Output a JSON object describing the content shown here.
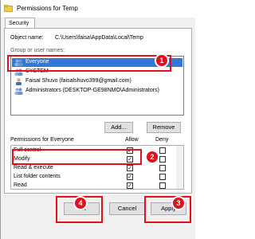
{
  "window": {
    "title": "Permissions for Temp"
  },
  "tabs": [
    {
      "label": "Security"
    }
  ],
  "object": {
    "label": "Object name:",
    "value": "C:\\Users\\faisa\\AppData\\Local\\Temp"
  },
  "groups": {
    "label": "Group or user names:",
    "items": [
      {
        "label": "Everyone",
        "selected": true
      },
      {
        "label": "SYSTEM",
        "selected": false
      },
      {
        "label": "Faisal Shuvo (faisalshuvo399@gmail.com)",
        "selected": false
      },
      {
        "label": "Administrators (DESKTOP-GE98NMO\\Administrators)",
        "selected": false
      }
    ],
    "add_label": "Add...",
    "remove_label": "Remove"
  },
  "permissions": {
    "header": "Permissions for Everyone",
    "allow_header": "Allow",
    "deny_header": "Deny",
    "rows": [
      {
        "name": "Full control",
        "allow": true,
        "deny": false
      },
      {
        "name": "Modify",
        "allow": true,
        "deny": false
      },
      {
        "name": "Read & execute",
        "allow": true,
        "deny": false
      },
      {
        "name": "List folder contents",
        "allow": true,
        "deny": false
      },
      {
        "name": "Read",
        "allow": true,
        "deny": false
      }
    ]
  },
  "buttons": {
    "ok": "OK",
    "cancel": "Cancel",
    "apply": "Apply"
  },
  "callouts": [
    "1",
    "2",
    "3",
    "4"
  ],
  "colors": {
    "callout": "#e0101c",
    "selection": "#3379d4"
  }
}
